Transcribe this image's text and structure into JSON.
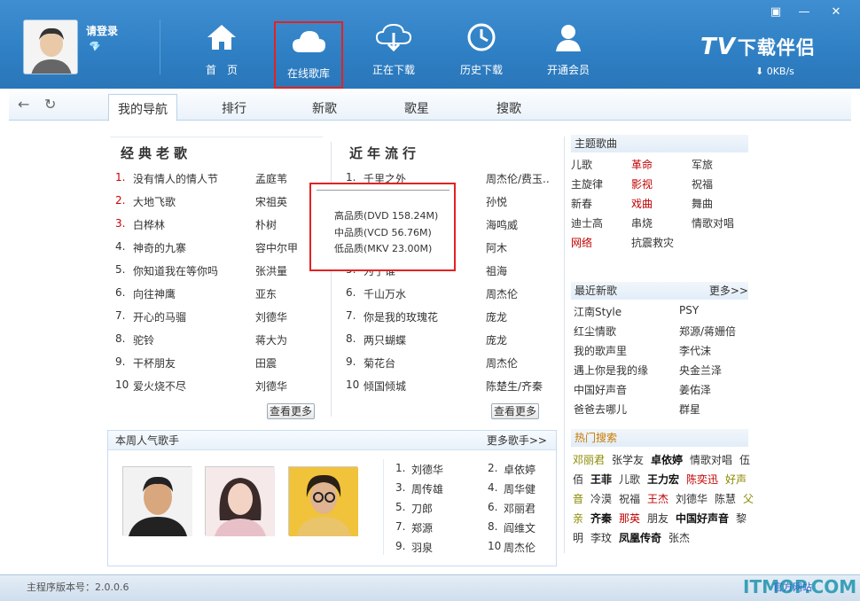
{
  "colors": {
    "accent": "#2f7fc4",
    "red": "#c00000",
    "highlight_box": "#e32222"
  },
  "user": {
    "login": "请登录",
    "badge": "💎"
  },
  "nav": [
    {
      "label": "首　页",
      "icon": "home-icon"
    },
    {
      "label": "在线歌库",
      "icon": "cloud-icon",
      "selected": true
    },
    {
      "label": "正在下载",
      "icon": "cloud-download-icon"
    },
    {
      "label": "历史下载",
      "icon": "history-icon"
    },
    {
      "label": "开通会员",
      "icon": "vip-user-icon"
    }
  ],
  "brand": {
    "tv": "TV",
    "name": "下载伴侣",
    "speed": "0KB/s"
  },
  "tabs": [
    "我的导航",
    "排行",
    "新歌",
    "歌星",
    "搜歌"
  ],
  "classic": {
    "title": "经典老歌",
    "more": "查看更多",
    "songs": [
      {
        "no": "1.",
        "title": "没有情人的情人节",
        "artist": "孟庭苇"
      },
      {
        "no": "2.",
        "title": "大地飞歌",
        "artist": "宋祖英"
      },
      {
        "no": "3.",
        "title": "白桦林",
        "artist": "朴树"
      },
      {
        "no": "4.",
        "title": "神奇的九寨",
        "artist": "容中尔甲"
      },
      {
        "no": "5.",
        "title": "你知道我在等你吗",
        "artist": "张洪量"
      },
      {
        "no": "6.",
        "title": "向往神鹰",
        "artist": "亚东"
      },
      {
        "no": "7.",
        "title": "开心的马骝",
        "artist": "刘德华"
      },
      {
        "no": "8.",
        "title": "驼铃",
        "artist": "蒋大为"
      },
      {
        "no": "9.",
        "title": "干杯朋友",
        "artist": "田震"
      },
      {
        "no": "10",
        "title": "爱火烧不尽",
        "artist": "刘德华"
      }
    ]
  },
  "recent": {
    "title": "近年流行",
    "more": "查看更多",
    "songs": [
      {
        "no": "1.",
        "title": "千里之外",
        "artist": "周杰伦/费玉.."
      },
      {
        "no": "2.",
        "title": "",
        "artist": "孙悦"
      },
      {
        "no": "3.",
        "title": "",
        "artist": "海鸣威"
      },
      {
        "no": "4.",
        "title": "",
        "artist": "阿木"
      },
      {
        "no": "5.",
        "title": "为了谁",
        "artist": "祖海"
      },
      {
        "no": "6.",
        "title": "千山万水",
        "artist": "周杰伦"
      },
      {
        "no": "7.",
        "title": "你是我的玫瑰花",
        "artist": "庞龙"
      },
      {
        "no": "8.",
        "title": "两只蝴蝶",
        "artist": "庞龙"
      },
      {
        "no": "9.",
        "title": "菊花台",
        "artist": "周杰伦"
      },
      {
        "no": "10",
        "title": "倾国倾城",
        "artist": "陈楚生/齐秦"
      }
    ]
  },
  "quality": [
    "高品质(DVD 158.24M)",
    "中品质(VCD 56.76M)",
    "低品质(MKV 23.00M)"
  ],
  "weekly": {
    "title": "本周人气歌手",
    "more": "更多歌手>>",
    "ranks": [
      {
        "n": "1.",
        "name": "刘德华"
      },
      {
        "n": "2.",
        "name": "卓依婷"
      },
      {
        "n": "3.",
        "name": "周传雄"
      },
      {
        "n": "4.",
        "name": "周华健"
      },
      {
        "n": "5.",
        "name": "刀郎"
      },
      {
        "n": "6.",
        "name": "邓丽君"
      },
      {
        "n": "7.",
        "name": "郑源"
      },
      {
        "n": "8.",
        "name": "阎维文"
      },
      {
        "n": "9.",
        "name": "羽泉"
      },
      {
        "n": "10",
        "name": "周杰伦"
      }
    ]
  },
  "themes": {
    "title": "主题歌曲",
    "items": [
      {
        "t": "儿歌",
        "red": false
      },
      {
        "t": "革命",
        "red": true
      },
      {
        "t": "军旅",
        "red": false
      },
      {
        "t": "主旋律",
        "red": false
      },
      {
        "t": "影视",
        "red": true
      },
      {
        "t": "祝福",
        "red": false
      },
      {
        "t": "新春",
        "red": false
      },
      {
        "t": "戏曲",
        "red": true
      },
      {
        "t": "舞曲",
        "red": false
      },
      {
        "t": "迪士高",
        "red": false
      },
      {
        "t": "串烧",
        "red": false
      },
      {
        "t": "情歌对唱",
        "red": false
      },
      {
        "t": "网络",
        "red": true
      },
      {
        "t": "抗震救灾",
        "red": false
      }
    ]
  },
  "newsongs": {
    "title": "最近新歌",
    "more": "更多>>",
    "items": [
      "江南Style",
      "PSY",
      "红尘情歌",
      "郑源/蒋姗倍",
      "我的歌声里",
      "李代沫",
      "遇上你是我的缘",
      "央金兰泽",
      "中国好声音",
      "姜佑泽",
      "爸爸去哪儿",
      "群星"
    ]
  },
  "hot": {
    "title": "热门搜索",
    "rows": [
      [
        {
          "t": "邓丽君",
          "c": "olive"
        },
        {
          "t": "张学友",
          "c": "dark"
        },
        {
          "t": "卓依婷",
          "c": "black"
        },
        {
          "t": "情歌对唱",
          "c": "dark"
        },
        {
          "t": "伍",
          "c": "dark"
        }
      ],
      [
        {
          "t": "佰",
          "c": "dark"
        },
        {
          "t": "王菲",
          "c": "black"
        },
        {
          "t": "儿歌",
          "c": "dark"
        },
        {
          "t": "王力宏",
          "c": "black"
        },
        {
          "t": "陈奕迅",
          "c": "red"
        },
        {
          "t": "好声",
          "c": "olive"
        }
      ],
      [
        {
          "t": "音",
          "c": "olive"
        },
        {
          "t": "冷漠",
          "c": "dark"
        },
        {
          "t": "祝福",
          "c": "dark"
        },
        {
          "t": "王杰",
          "c": "red"
        },
        {
          "t": "刘德华",
          "c": "dark"
        },
        {
          "t": "陈慧",
          "c": "dark"
        },
        {
          "t": "父",
          "c": "olive"
        }
      ],
      [
        {
          "t": "亲",
          "c": "olive"
        },
        {
          "t": "齐秦",
          "c": "black"
        },
        {
          "t": "那英",
          "c": "red"
        },
        {
          "t": "朋友",
          "c": "dark"
        },
        {
          "t": "中国好声音",
          "c": "black"
        },
        {
          "t": "黎",
          "c": "dark"
        }
      ],
      [
        {
          "t": "明",
          "c": "dark"
        },
        {
          "t": "李玟",
          "c": "dark"
        },
        {
          "t": "凤凰传奇",
          "c": "black"
        },
        {
          "t": "张杰",
          "c": "dark"
        }
      ]
    ]
  },
  "status": {
    "version": "主程序版本号：2.0.0.6",
    "site": "官方网站",
    "watermark": "ITMOP.COM"
  }
}
